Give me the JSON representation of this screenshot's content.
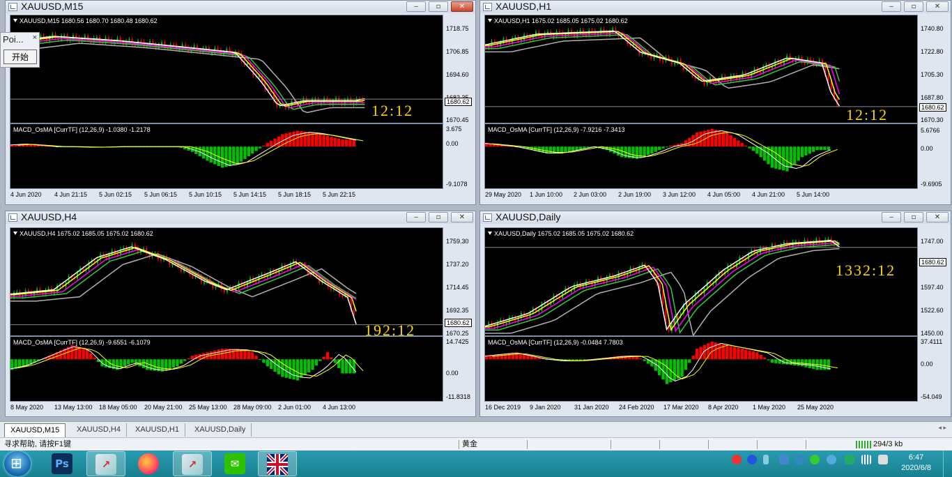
{
  "windows": [
    {
      "id": "m15",
      "title": "XAUUSD,M15",
      "active": true,
      "chart_header": "XAUUSD,M15  1680.56 1680.70 1680.48 1680.62",
      "price_labels": [
        "1718.75",
        "1706.85",
        "1694.60",
        "1682.35",
        "1670.45"
      ],
      "current_price": "1680.62",
      "timer": "12:12",
      "macd_header": "MACD_OsMA [CurrTF] (12,26,9) -1.0380 -1.2178",
      "macd_labels": [
        "3.675",
        "0.00",
        "-9.1078"
      ],
      "time_labels": [
        "4 Jun 2020",
        "4 Jun 21:15",
        "5 Jun 02:15",
        "5 Jun 06:15",
        "5 Jun 10:15",
        "5 Jun 14:15",
        "5 Jun 18:15",
        "5 Jun 22:15"
      ]
    },
    {
      "id": "h1",
      "title": "XAUUSD,H1",
      "active": false,
      "chart_header": "XAUUSD,H1  1675.02 1685.05 1675.02 1680.62",
      "price_labels": [
        "1740.80",
        "1722.80",
        "1705.30",
        "1687.80",
        "1670.30"
      ],
      "current_price": "1680.62",
      "timer": "12:12",
      "macd_header": "MACD_OsMA [CurrTF] (12,26,9) -7.9216 -7.3413",
      "macd_labels": [
        "5.6766",
        "0.00",
        "-9.6905"
      ],
      "time_labels": [
        "29 May 2020",
        "1 Jun 10:00",
        "2 Jun 03:00",
        "2 Jun 19:00",
        "3 Jun 12:00",
        "4 Jun 05:00",
        "4 Jun 21:00",
        "5 Jun 14:00"
      ]
    },
    {
      "id": "h4",
      "title": "XAUUSD,H4",
      "active": false,
      "chart_header": "XAUUSD,H4  1675.02 1685.05 1675.02 1680.62",
      "price_labels": [
        "1759.30",
        "1737.20",
        "1714.45",
        "1692.35",
        "1670.25"
      ],
      "current_price": "1680.62",
      "timer": "192:12",
      "macd_header": "MACD_OsMA [CurrTF] (12,26,9) -9.6551 -6.1079",
      "macd_labels": [
        "14.7425",
        "0.00",
        "-11.8318"
      ],
      "time_labels": [
        "8 May 2020",
        "13 May 13:00",
        "18 May 05:00",
        "20 May 21:00",
        "25 May 13:00",
        "28 May 09:00",
        "2 Jun 01:00",
        "4 Jun 13:00"
      ]
    },
    {
      "id": "daily",
      "title": "XAUUSD,Daily",
      "active": false,
      "chart_header": "XAUUSD,Daily  1675.02 1685.05 1675.02 1680.62",
      "price_labels": [
        "1747.00",
        "1672.20",
        "1597.40",
        "1522.60",
        "1450.00"
      ],
      "current_price": "1680.62",
      "timer": "1332:12",
      "macd_header": "MACD_OsMA [CurrTF] (12,26,9) -0.0484 7.7803",
      "macd_labels": [
        "37.4111",
        "0.00",
        "-54.049"
      ],
      "time_labels": [
        "16 Dec 2019",
        "9 Jan 2020",
        "31 Jan 2020",
        "24 Feb 2020",
        "17 Mar 2020",
        "8 Apr 2020",
        "1 May 2020",
        "25 May 2020"
      ]
    }
  ],
  "popup": {
    "title": "Poi...",
    "close": "×",
    "button": "开始"
  },
  "tabs": [
    "XAUUSD,M15",
    "XAUUSD,H4",
    "XAUUSD,H1",
    "XAUUSD,Daily"
  ],
  "status": {
    "help": "寻求帮助, 请按F1键",
    "profile": "黄金",
    "traffic": "294/3 kb"
  },
  "clock": {
    "time": "6:47",
    "date": "2020/6/8"
  },
  "taskbar_apps": [
    "windows-start",
    "photoshop",
    "metatrader",
    "firefox",
    "metatrader",
    "wechat",
    "uk-flag-app"
  ],
  "colors": {
    "bull": "#00c000",
    "bear": "#ff0000",
    "ma_fast": "#ffffff",
    "ma_mid": "#ffff00",
    "ma_magenta": "#ff00ff",
    "ma_green": "#32cd32",
    "ma_gray": "#b0b0b0",
    "timer": "#ffd700",
    "macd_pos": "#ff0000",
    "macd_neg": "#00c000"
  }
}
